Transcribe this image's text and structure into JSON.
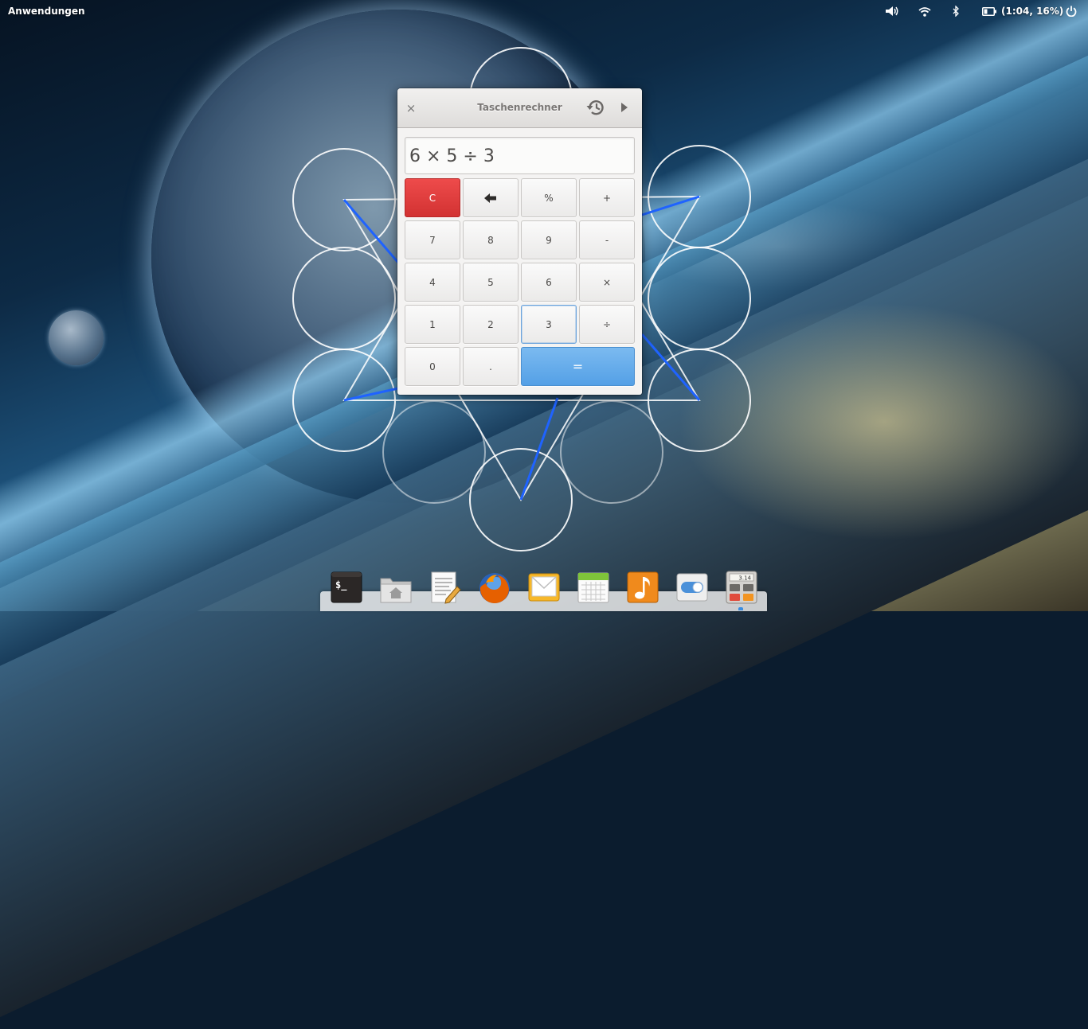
{
  "top_panel": {
    "applications_label": "Anwendungen",
    "battery_status": "(1:04, 16%)",
    "icons": [
      "volume-icon",
      "wifi-icon",
      "bluetooth-icon",
      "battery-icon",
      "power-icon"
    ]
  },
  "window": {
    "title": "Taschenrechner",
    "close_glyph": "×",
    "display_value": "6 × 5 ÷ 3"
  },
  "keypad": {
    "rows": [
      [
        "C",
        "🡐",
        "%",
        "+"
      ],
      [
        "7",
        "8",
        "9",
        "-"
      ],
      [
        "4",
        "5",
        "6",
        "×"
      ],
      [
        "1",
        "2",
        "3",
        "÷"
      ],
      [
        "0",
        ".",
        "="
      ]
    ],
    "clear_label": "C",
    "backspace_label": "",
    "percent_label": "%",
    "add_label": "+",
    "seven": "7",
    "eight": "8",
    "nine": "9",
    "subtract_label": "-",
    "four": "4",
    "five": "5",
    "six": "6",
    "multiply_label": "×",
    "one": "1",
    "two": "2",
    "three": "3",
    "divide_label": "÷",
    "zero": "0",
    "decimal_label": ".",
    "equals_label": "="
  },
  "dock": {
    "items": [
      "terminal",
      "files",
      "text-editor",
      "firefox",
      "mail",
      "calendar",
      "music",
      "system-settings",
      "calculator"
    ],
    "calculator_icon_text": "3.14",
    "terminal_icon_text": "$_"
  },
  "colors": {
    "clear_key": "#e23d3d",
    "equals_key": "#62a8ea",
    "dock_active": "#3b8de0"
  }
}
